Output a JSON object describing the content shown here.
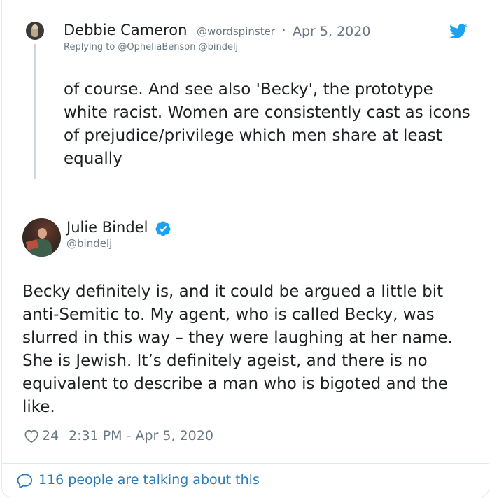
{
  "parent_tweet": {
    "avatar_icon": "owl-avatar-icon",
    "author_name": "Debbie Cameron",
    "author_handle": "@wordspinster",
    "separator": "·",
    "date": "Apr 5, 2020",
    "reply_prefix": "Replying to @OpheliaBenson @bindelj",
    "text": "of course. And see also 'Becky', the prototype white racist. Women are consistently cast as icons of prejudice/privilege which men share at least equally",
    "brand_icon": "twitter-bird-icon"
  },
  "main_tweet": {
    "author_name": "Julie Bindel",
    "author_handle": "@bindelj",
    "verified_icon": "verified-badge-icon",
    "text": "Becky definitely is, and it could be argued a little bit anti-Semitic to. My agent, who is called Becky, was slurred in this way – they were laughing at her name. She is Jewish. It’s definitely ageist, and there is no equivalent to describe a man who is bigoted and the like.",
    "like_icon": "heart-icon",
    "like_count": "24",
    "timestamp": "2:31 PM - Apr 5, 2020"
  },
  "footer": {
    "bubble_icon": "speech-bubble-icon",
    "talking_text": "116 people are talking about this"
  },
  "colors": {
    "twitter_blue": "#1da1f2",
    "link_blue": "#2b7bb9",
    "secondary_text": "#697882",
    "primary_text": "#1c2022",
    "border": "#e1e8ed",
    "thread_line": "#ccd6dd"
  }
}
